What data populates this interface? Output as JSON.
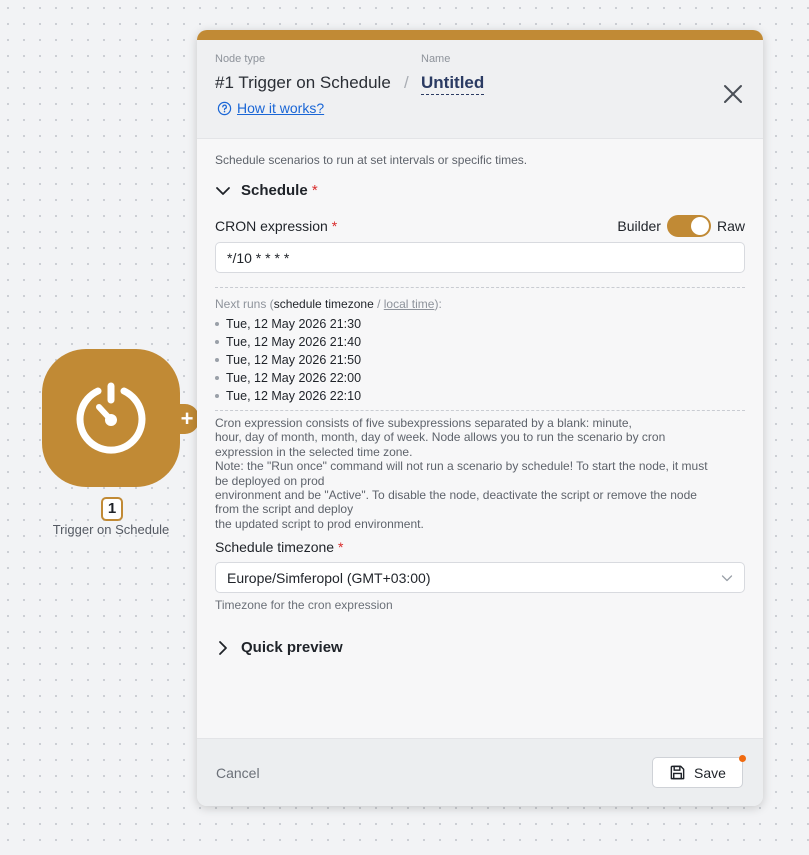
{
  "node": {
    "index": "1",
    "label": "Trigger on Schedule",
    "color": "#c18a35"
  },
  "panel": {
    "accent_color": "#c18a35",
    "header": {
      "type_label": "Node type",
      "type_value": "#1 Trigger on Schedule",
      "separator": "/",
      "name_label": "Name",
      "name_value": "Untitled",
      "help_link": "How it works?"
    },
    "description": "Schedule scenarios to run at set intervals or specific times.",
    "schedule": {
      "title": "Schedule",
      "required_mark": "*",
      "cron_label": "CRON expression",
      "toggle_left": "Builder",
      "toggle_right": "Raw",
      "toggle_on": true,
      "cron_value": "*/10 * * * *",
      "next_runs_prefix": "Next runs (",
      "next_runs_tz": "schedule timezone",
      "next_runs_sep": " / ",
      "next_runs_local": "local time",
      "next_runs_suffix": "):",
      "runs": [
        "Tue, 12 May 2026 21:30",
        "Tue, 12 May 2026 21:40",
        "Tue, 12 May 2026 21:50",
        "Tue, 12 May 2026 22:00",
        "Tue, 12 May 2026 22:10"
      ],
      "note_lines": [
        "Cron expression consists of five subexpressions separated by a blank: minute,",
        "hour, day of month, month, day of week. Node allows you to run the scenario by cron",
        "expression in the selected time zone.",
        "Note: the \"Run once\" command will not run a scenario by schedule! To start the node, it must",
        "be deployed on prod",
        "environment and be \"Active\". To disable the node, deactivate the script or remove the node",
        "from the script and deploy",
        "the updated script to prod environment."
      ],
      "timezone_label": "Schedule timezone",
      "timezone_value": "Europe/Simferopol (GMT+03:00)",
      "timezone_hint": "Timezone for the cron expression"
    },
    "quick_preview": {
      "title": "Quick preview"
    },
    "footer": {
      "cancel_label": "Cancel",
      "save_label": "Save",
      "unsaved_dot_color": "#f06a0f"
    }
  }
}
